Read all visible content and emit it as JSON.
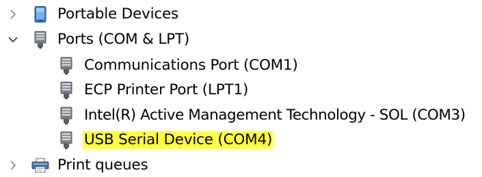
{
  "tree": {
    "items": [
      {
        "label": "Portable Devices",
        "expanded": false,
        "icon": "portable-device-icon",
        "level": 0
      },
      {
        "label": "Ports (COM & LPT)",
        "expanded": true,
        "icon": "port-connector-icon",
        "level": 0
      },
      {
        "label": "Communications Port (COM1)",
        "icon": "port-connector-icon",
        "level": 1
      },
      {
        "label": "ECP Printer Port (LPT1)",
        "icon": "port-connector-icon",
        "level": 1
      },
      {
        "label": "Intel(R) Active Management Technology - SOL (COM3)",
        "icon": "port-connector-icon",
        "level": 1
      },
      {
        "label": "USB Serial Device (COM4)",
        "icon": "port-connector-icon",
        "level": 1,
        "highlighted": true,
        "highlight_color": "#ffff3c"
      },
      {
        "label": "Print queues",
        "expanded": false,
        "icon": "printer-icon",
        "level": 0
      }
    ]
  }
}
